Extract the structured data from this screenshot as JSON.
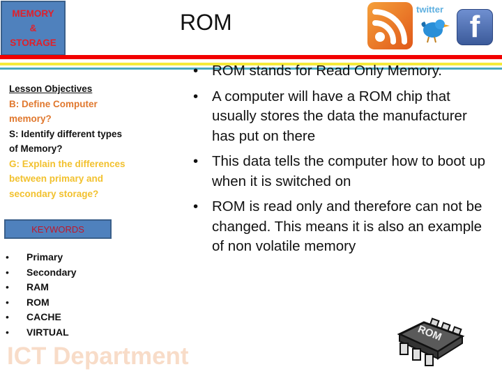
{
  "title_box": {
    "line1": "MEMORY",
    "line2": "&",
    "line3": "STORAGE"
  },
  "heading": "ROM",
  "objectives": {
    "title": "Lesson Objectives",
    "b": "B: Define Computer memory?",
    "s": "S: Identify different types of Memory?",
    "g": "G: Explain the differences between primary and secondary storage?"
  },
  "keywords": {
    "label": "KEYWORDS",
    "items": [
      "Primary",
      "Secondary",
      "RAM",
      "ROM",
      "CACHE",
      "VIRTUAL"
    ],
    "bullet": "•"
  },
  "watermark": "ICT Department",
  "body": {
    "bullet": "•",
    "items": [
      "ROM stands for Read Only Memory.",
      "A computer will have a ROM chip that usually stores the data the manufacturer has put on there",
      "This data tells the computer how to boot up when it is switched on",
      "ROM is read only and therefore can not be changed. This means it is also an example of non volatile memory"
    ]
  },
  "social": {
    "twitter_label": "twitter",
    "facebook_glyph": "f"
  },
  "chip_label": "ROM",
  "colors": {
    "box_blue": "#4f81bd",
    "title_red": "#e0202a",
    "stripe_red": "#f20000",
    "stripe_yellow": "#f5ea3a",
    "stripe_teal": "#4aa9bf",
    "obj_b": "#e0782e",
    "obj_g": "#f2c12e"
  }
}
